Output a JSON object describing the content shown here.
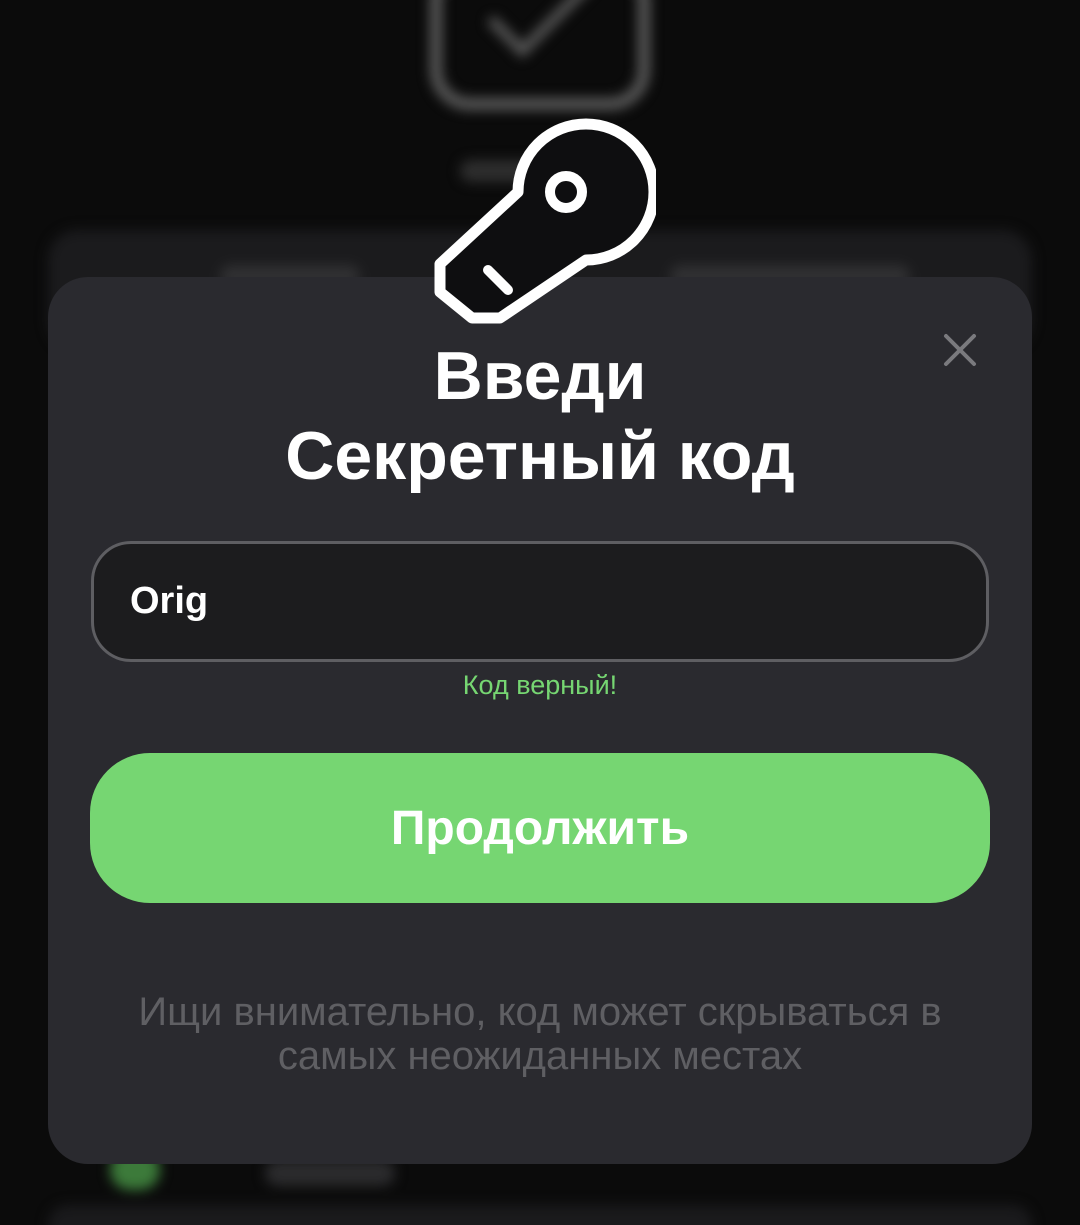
{
  "modal": {
    "title_line1": "Введи",
    "title_line2": "Секретный код",
    "code_value": "Orig",
    "status_text": "Код верный!",
    "continue_label": "Продолжить",
    "hint_text": "Ищи внимательно, код может скрываться в самых неожиданных местах"
  },
  "icons": {
    "header": "key-icon",
    "close": "close-icon"
  },
  "colors": {
    "accent": "#76d672",
    "modal_bg": "#2a2a2f",
    "input_bg": "#1c1c1e",
    "hint": "#5f5f63"
  }
}
